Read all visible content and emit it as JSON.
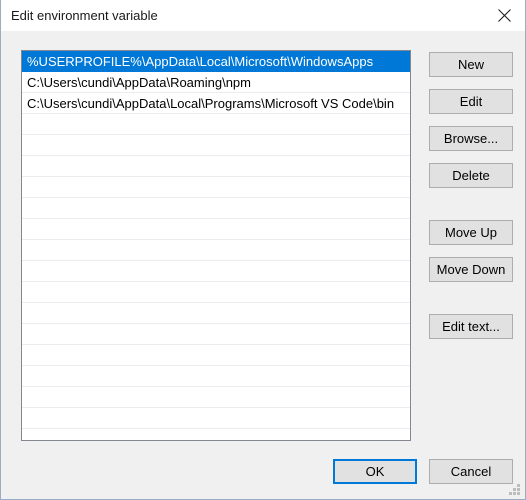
{
  "window": {
    "title": "Edit environment variable",
    "close_icon": "close-icon",
    "accent_color": "#0078d7",
    "dialog_background": "#f0f0f0",
    "listbox_background": "#ffffff",
    "button_face": "#e1e1e1"
  },
  "list": {
    "selected_index": 0,
    "visible_row_count": 18,
    "items": [
      "%USERPROFILE%\\AppData\\Local\\Microsoft\\WindowsApps",
      "C:\\Users\\cundi\\AppData\\Roaming\\npm",
      "C:\\Users\\cundi\\AppData\\Local\\Programs\\Microsoft VS Code\\bin"
    ]
  },
  "side_buttons": {
    "new": "New",
    "edit": "Edit",
    "browse": "Browse...",
    "delete": "Delete",
    "move_up": "Move Up",
    "move_down": "Move Down",
    "edit_text": "Edit text..."
  },
  "bottom_buttons": {
    "ok": "OK",
    "cancel": "Cancel"
  }
}
